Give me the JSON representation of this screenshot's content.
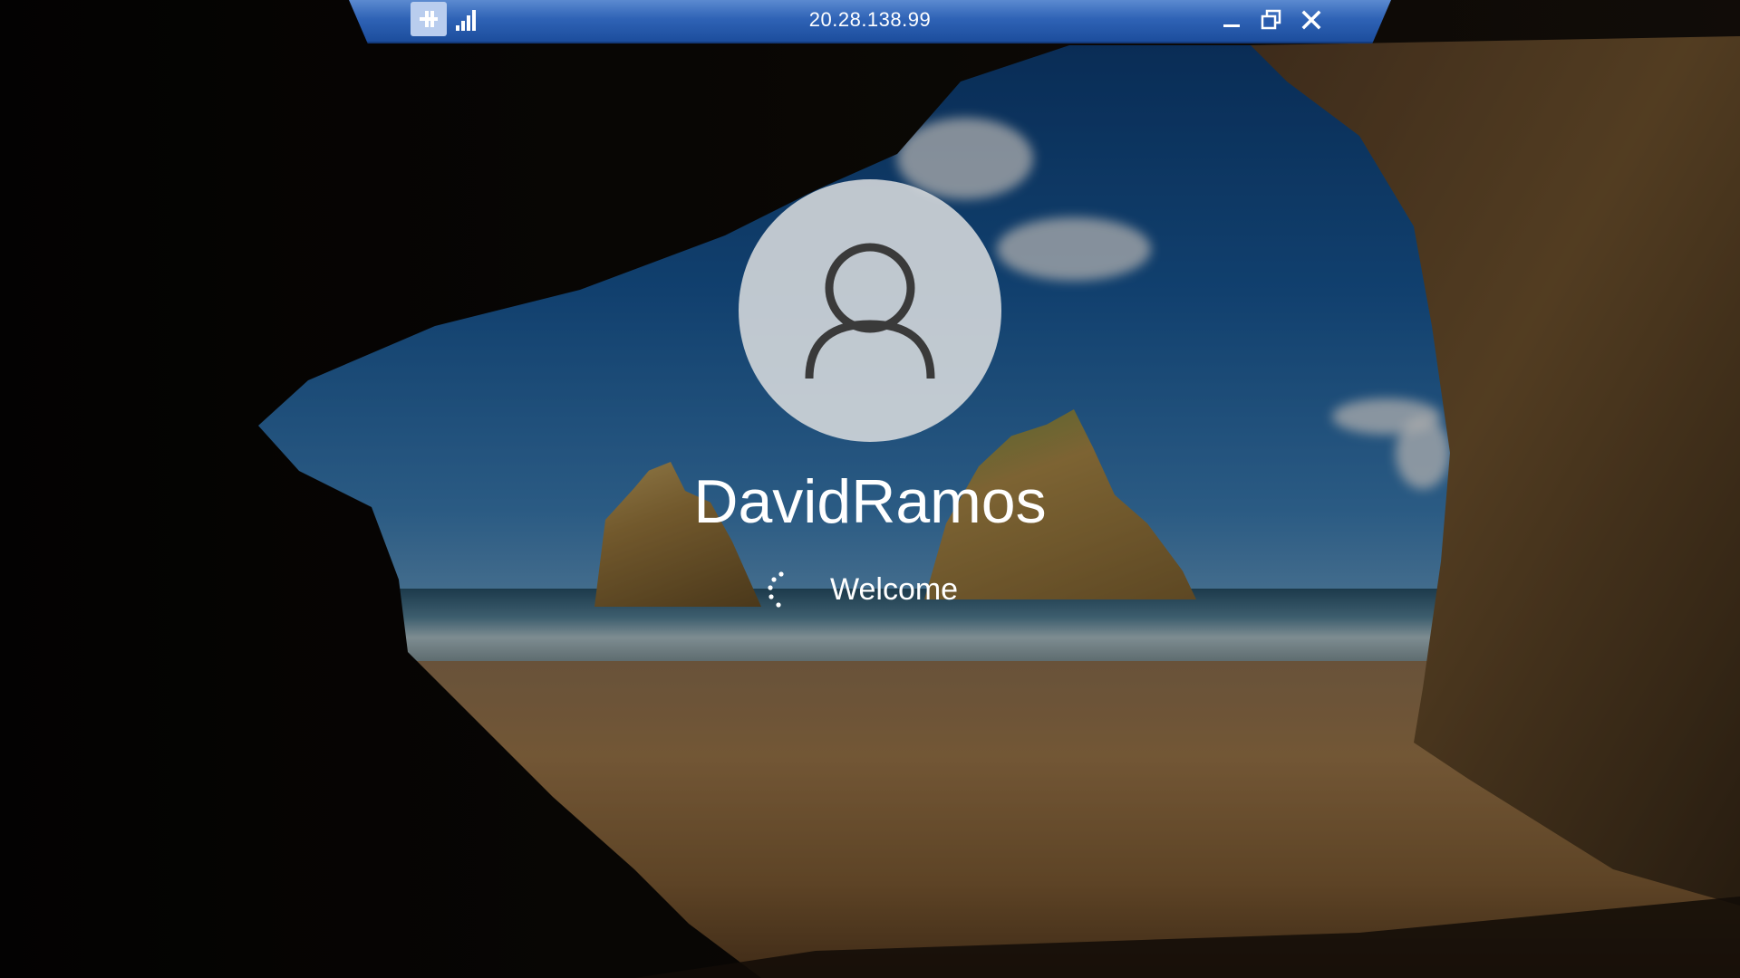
{
  "rdp_bar": {
    "title": "20.28.138.99",
    "pin_icon": "pin-icon",
    "signal_icon": "connection-signal-icon",
    "minimize_icon": "minimize-icon",
    "restore_icon": "restore-icon",
    "close_icon": "close-icon",
    "bar_color": "#2f63b6"
  },
  "sign_in": {
    "avatar_icon": "user-icon",
    "username": "DavidRamos",
    "status_text": "Welcome",
    "spinner_icon": "loading-spinner-icon"
  }
}
